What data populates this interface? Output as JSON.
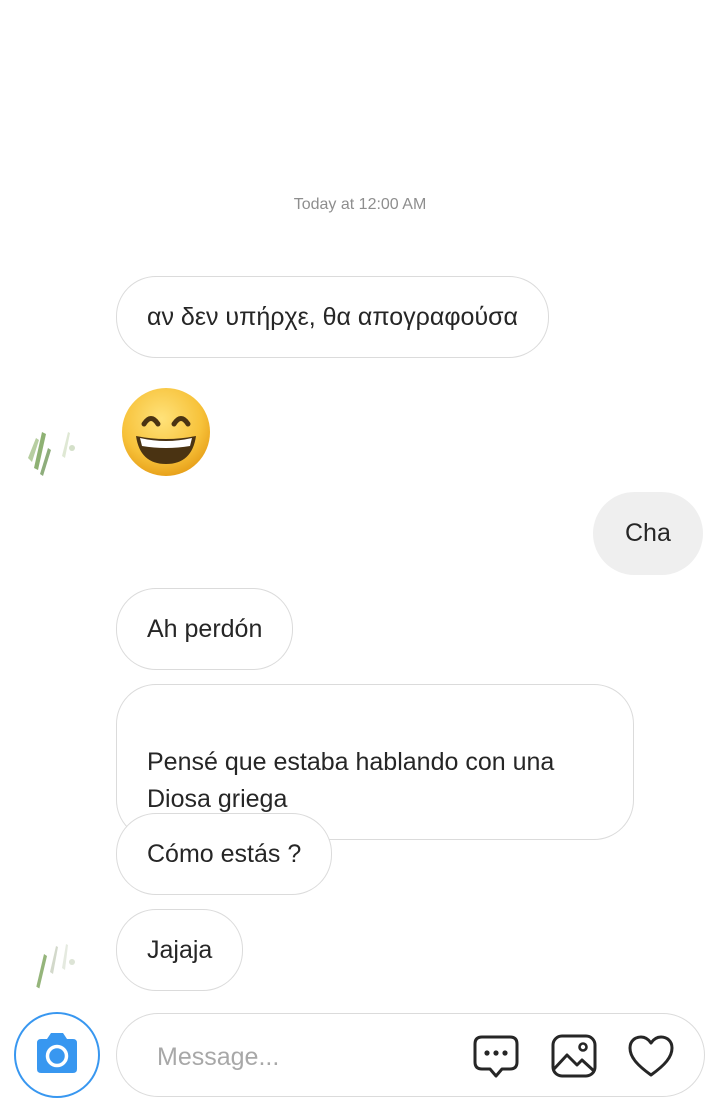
{
  "thread": {
    "timestamp": "Today at 12:00 AM",
    "messages": [
      {
        "sender": "them",
        "text": "αν δεν υπήρχε, θα απογραφούσα"
      },
      {
        "sender": "them",
        "emoji": "grinning-face-with-smiling-eyes"
      },
      {
        "sender": "me",
        "text": "Cha"
      },
      {
        "sender": "them",
        "text": "Ah perdón"
      },
      {
        "sender": "them",
        "text": "Pensé que estaba hablando con una\nDiosa griega"
      },
      {
        "sender": "them",
        "text": "Cómo estás ?"
      },
      {
        "sender": "them",
        "text": "Jajaja"
      }
    ]
  },
  "composer": {
    "placeholder": "Message...",
    "value": "",
    "icons": [
      "camera-icon",
      "chat-bubble-icon",
      "gallery-icon",
      "heart-icon"
    ]
  },
  "colors": {
    "accent": "#3897f0",
    "bubble_border": "#dbdbdb",
    "outgoing_bubble": "#efefef",
    "timestamp": "#8e8e8e"
  }
}
